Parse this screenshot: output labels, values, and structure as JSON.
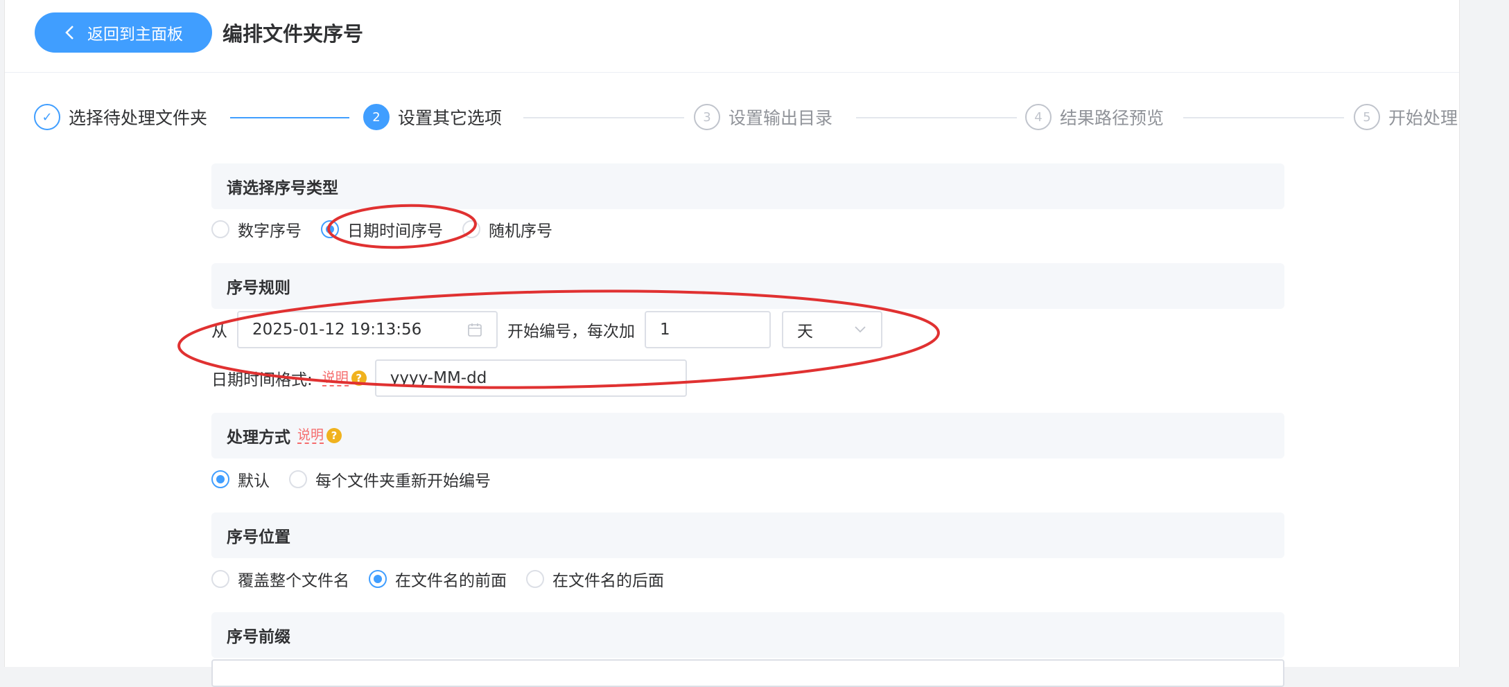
{
  "header": {
    "back_label": "返回到主面板",
    "title": "编排文件夹序号"
  },
  "steps": [
    {
      "number": "✓",
      "label": "选择待处理文件夹",
      "state": "done"
    },
    {
      "number": "2",
      "label": "设置其它选项",
      "state": "active"
    },
    {
      "number": "3",
      "label": "设置输出目录",
      "state": "wait"
    },
    {
      "number": "4",
      "label": "结果路径预览",
      "state": "wait"
    },
    {
      "number": "5",
      "label": "开始处理",
      "state": "wait"
    }
  ],
  "sections": {
    "serial_type": {
      "title": "请选择序号类型",
      "options": [
        "数字序号",
        "日期时间序号",
        "随机序号"
      ],
      "selected": "日期时间序号"
    },
    "serial_rule": {
      "title": "序号规则",
      "from_label": "从",
      "start_datetime": "2025-01-12 19:13:56",
      "increment_label": "开始编号，每次加",
      "increment_value": "1",
      "unit_value": "天",
      "format_label": "日期时间格式:",
      "format_help": "说明",
      "format_value": "yyyy-MM-dd"
    },
    "process_mode": {
      "title": "处理方式",
      "help": "说明",
      "options": [
        "默认",
        "每个文件夹重新开始编号"
      ],
      "selected": "默认"
    },
    "serial_position": {
      "title": "序号位置",
      "options": [
        "覆盖整个文件名",
        "在文件名的前面",
        "在文件名的后面"
      ],
      "selected": "在文件名的前面"
    },
    "serial_prefix": {
      "title": "序号前缀"
    }
  },
  "colors": {
    "primary": "#409eff",
    "annotation": "#e03131",
    "help_icon": "#f0b21e"
  },
  "icons": {
    "help": "?",
    "calendar": "calendar-icon",
    "dropdown": "chevron-down-icon"
  }
}
